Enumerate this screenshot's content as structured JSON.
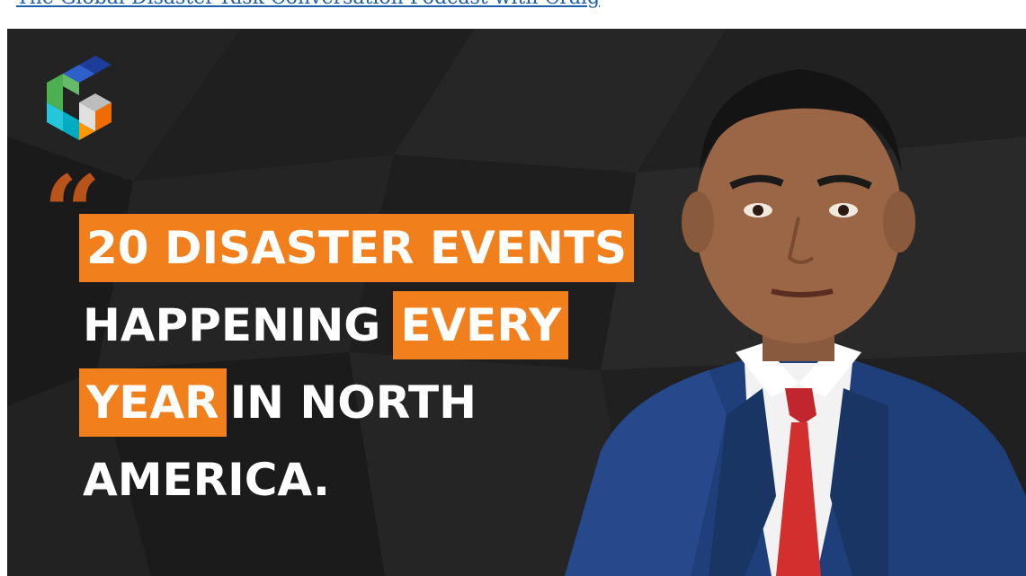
{
  "page": {
    "top_link_text": "The Global Disaster Risk Conversation Podcast with Craig"
  },
  "banner": {
    "logo_name": "g-cube-logo",
    "quote_glyph": "“",
    "headline": {
      "line1": {
        "part1": "20 DISASTER EVENTS"
      },
      "line2": {
        "part1": "HAPPENING",
        "part2": "EVERY"
      },
      "line3": {
        "part1": "YEAR",
        "part2": "IN NORTH"
      },
      "line4": {
        "part1": "AMERICA."
      }
    },
    "colors": {
      "accent": "#f07f1c",
      "background": "#1e1e1e",
      "quote": "#b8531a",
      "text": "#ffffff",
      "link": "#1d5fa8"
    },
    "person_image": "speaker-portrait"
  }
}
